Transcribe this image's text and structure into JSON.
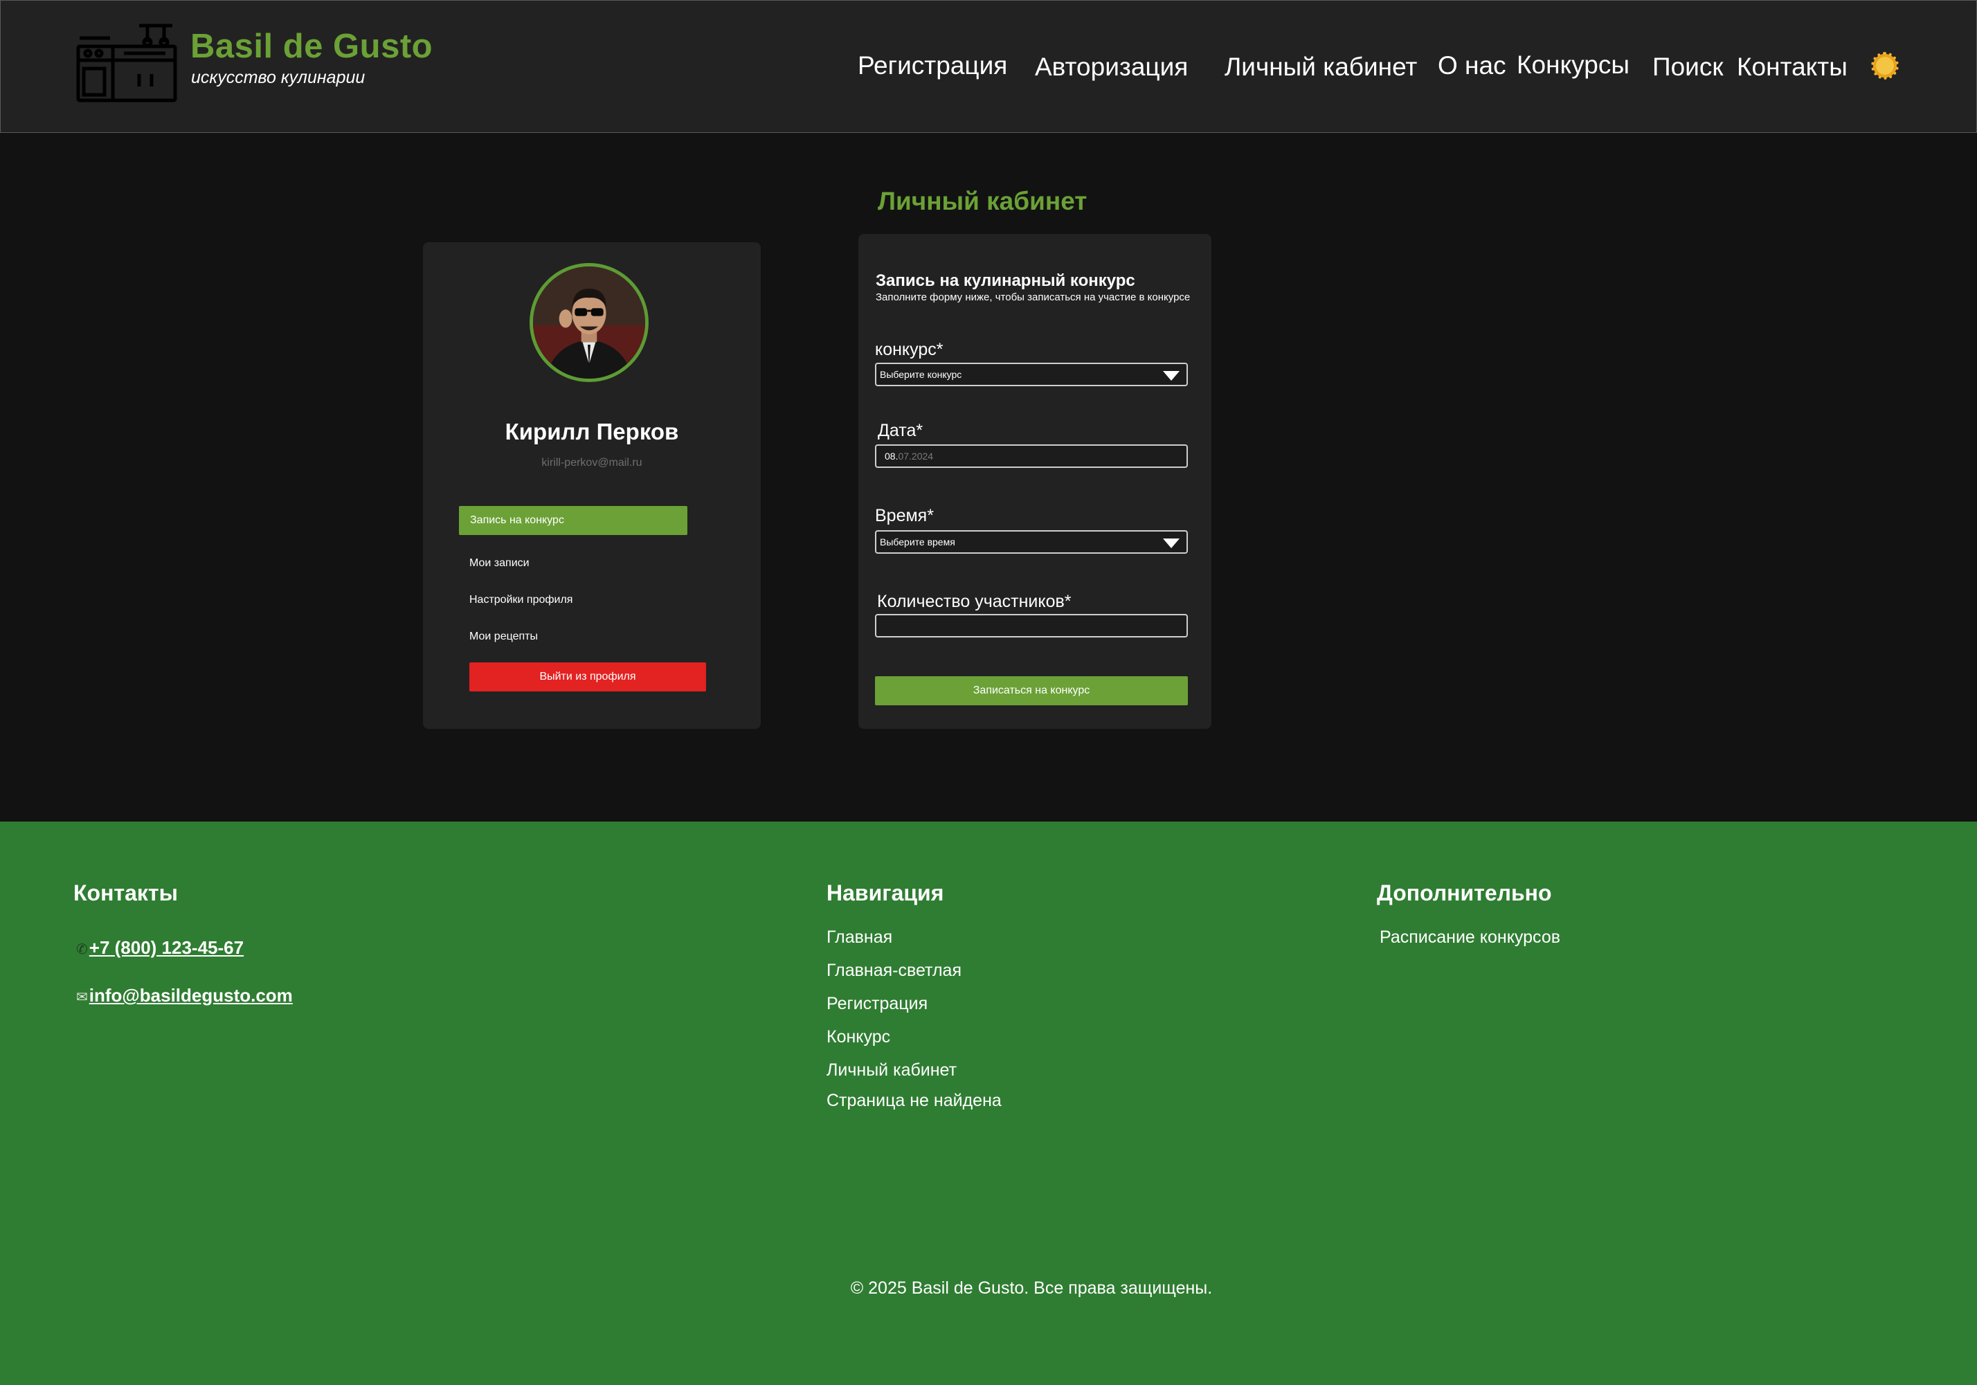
{
  "header": {
    "brand_title": "Basil de Gusto",
    "brand_subtitle": "искусство кулинарии",
    "logo_icon": "kitchen-stove-icon",
    "theme_icon": "sun-icon",
    "nav": {
      "registration": "Регистрация",
      "login": "Авторизация",
      "account": "Личный кабинет",
      "about": "О нас",
      "contests": "Конкурсы",
      "search": "Поиск",
      "contacts": "Контакты"
    }
  },
  "main": {
    "title": "Личный кабинет",
    "profile": {
      "name": "Кирилл Перков",
      "email": "kirill-perkov@mail.ru",
      "menu": {
        "active": "Запись на конкурс",
        "my_entries": "Мои записи",
        "settings": "Настройки профиля",
        "recipes": "Мои рецепты",
        "logout": "Выйти из профиля"
      }
    },
    "form": {
      "title": "Запись на кулинарный конкурс",
      "subtitle": "Заполните форму ниже, чтобы записаться на участие в конкурсе",
      "contest_label": "конкурс*",
      "contest_placeholder": "Выберите конкурс",
      "date_label": "Дата*",
      "date_day": "08.",
      "date_rest": "07.2024",
      "time_label": "Время*",
      "time_placeholder": "Выберите время",
      "participants_label": "Количество участников*",
      "participants_value": "",
      "submit": "Записаться на конкурс"
    }
  },
  "footer": {
    "contacts_heading": "Контакты",
    "phone": "+7 (800) 123-45-67",
    "email": "info@basildegusto.com",
    "phone_icon": "phone-icon",
    "email_icon": "envelope-icon",
    "nav_heading": "Навигация",
    "nav_links": [
      "Главная",
      "Главная-светлая",
      "Регистрация",
      "Конкурс",
      "Личный кабинет",
      "Страница не найдена"
    ],
    "extra_heading": "Дополнительно",
    "extra_links": [
      "Расписание конкурсов"
    ],
    "copyright": "© 2025 Basil de Gusto. Все права защищены."
  },
  "colors": {
    "accent_green": "#6ba136",
    "footer_green": "#2f7d32",
    "header_bg": "#222222",
    "page_bg": "#121212",
    "danger_red": "#e32222"
  }
}
